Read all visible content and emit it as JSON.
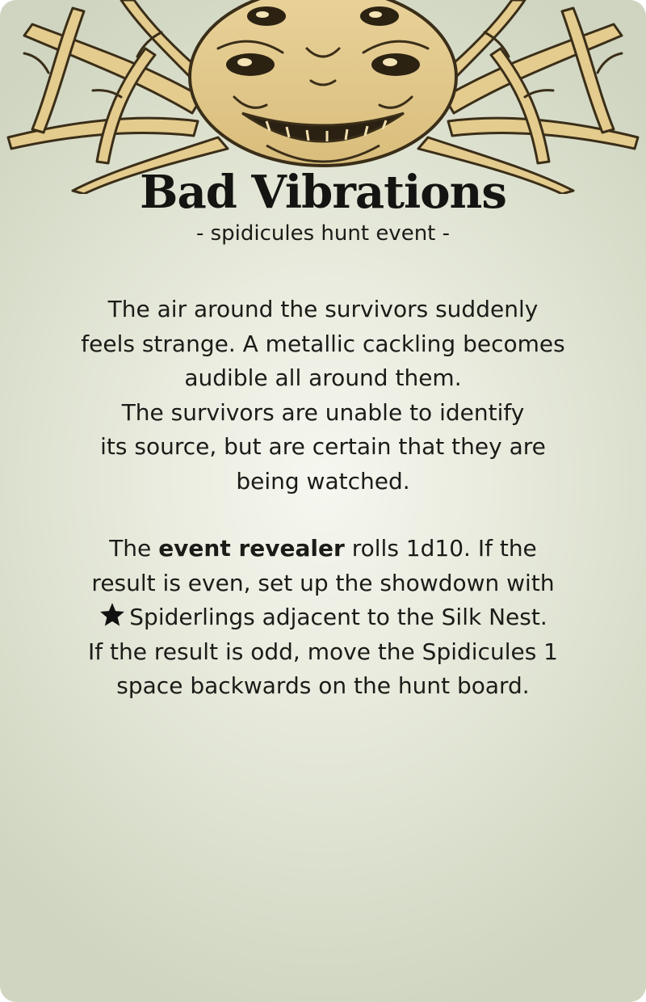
{
  "card": {
    "title": "Bad Vibrations",
    "subtitle": "- spidicules hunt event -",
    "flavor_lines": [
      "The air around the survivors suddenly",
      "feels strange. A metallic cackling becomes",
      "audible all around them.",
      "The survivors are unable to identify",
      "its source, but are certain that they are",
      "being watched."
    ],
    "rules": {
      "line1_pre": "The ",
      "line1_bold": "event revealer",
      "line1_post": " rolls 1d10. If the",
      "line2": "result is even, set up the showdown with",
      "line3_text": "Spiderlings adjacent to the Silk Nest.",
      "line4": "If the result is odd, move the Spidicules 1",
      "line5": "space backwards on the hunt board."
    },
    "icons": {
      "header_art": "spidicules-monster-art",
      "rule_icon": "star-icon"
    },
    "colors": {
      "background": "#e6e9da",
      "art": "#e2c98e",
      "ink": "#1b1b18"
    }
  }
}
